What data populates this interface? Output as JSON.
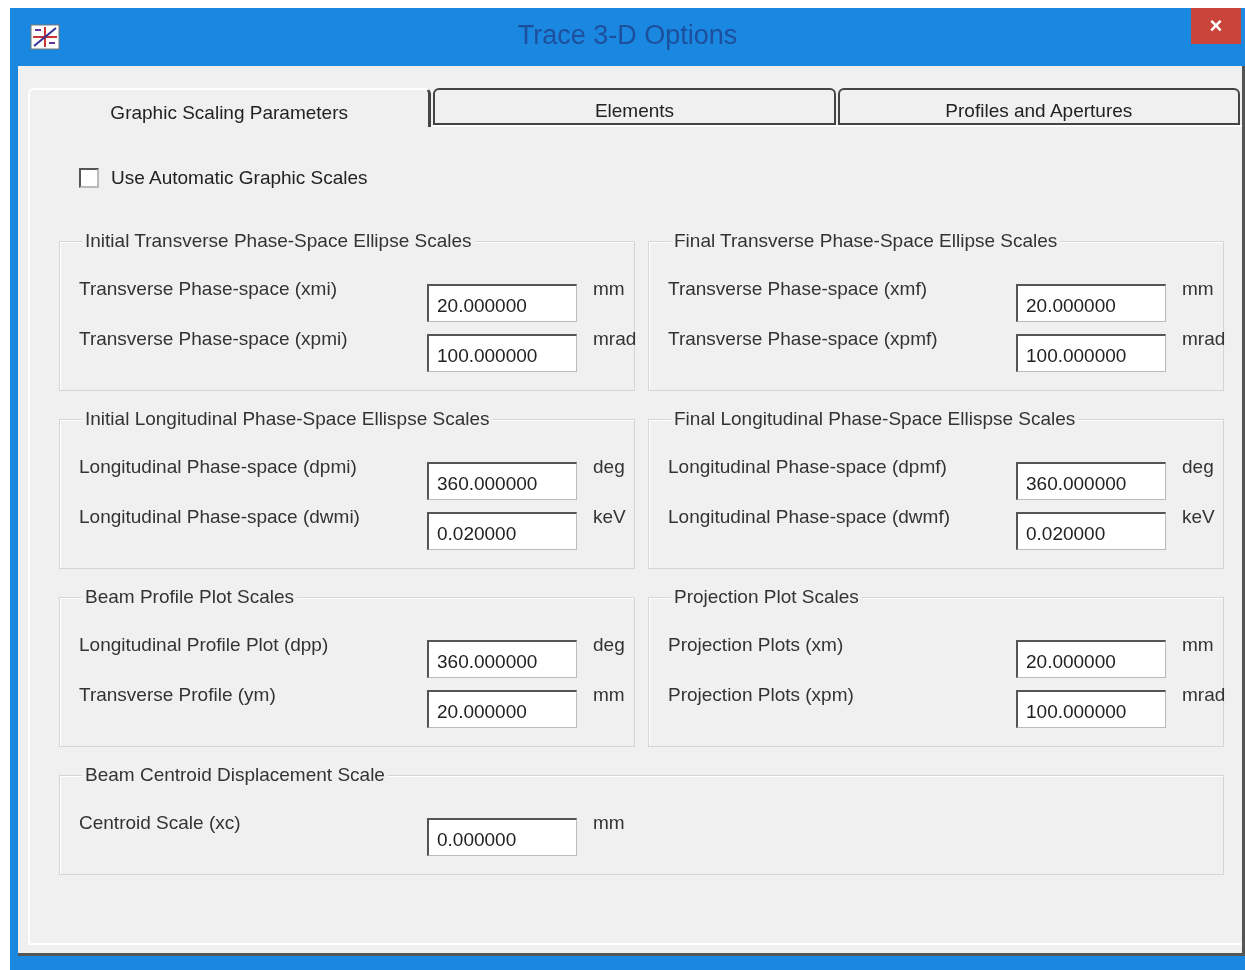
{
  "window": {
    "title": "Trace 3-D Options",
    "close": "×"
  },
  "tabs": [
    {
      "label": "Graphic Scaling Parameters",
      "selected": true
    },
    {
      "label": "Elements",
      "selected": false
    },
    {
      "label": "Profiles and Apertures",
      "selected": false
    }
  ],
  "auto_scales": {
    "label": "Use Automatic Graphic Scales",
    "checked": false
  },
  "groups": [
    {
      "title": "Initial Transverse Phase-Space Ellipse Scales",
      "fields": [
        {
          "label": "Transverse Phase-space (xmi)",
          "value": "20.000000",
          "unit": "mm"
        },
        {
          "label": "Transverse Phase-space (xpmi)",
          "value": "100.000000",
          "unit": "mrad"
        }
      ]
    },
    {
      "title": "Final Transverse Phase-Space Ellipse Scales",
      "fields": [
        {
          "label": "Transverse Phase-space (xmf)",
          "value": "20.000000",
          "unit": "mm"
        },
        {
          "label": "Transverse Phase-space (xpmf)",
          "value": "100.000000",
          "unit": "mrad"
        }
      ]
    },
    {
      "title": "Initial Longitudinal Phase-Space Ellispse Scales",
      "fields": [
        {
          "label": "Longitudinal Phase-space (dpmi)",
          "value": "360.000000",
          "unit": "deg"
        },
        {
          "label": "Longitudinal Phase-space (dwmi)",
          "value": "0.020000",
          "unit": "keV"
        }
      ]
    },
    {
      "title": "Final Longitudinal Phase-Space Ellispse Scales",
      "fields": [
        {
          "label": "Longitudinal Phase-space (dpmf)",
          "value": "360.000000",
          "unit": "deg"
        },
        {
          "label": "Longitudinal Phase-space (dwmf)",
          "value": "0.020000",
          "unit": "keV"
        }
      ]
    },
    {
      "title": "Beam Profile Plot Scales",
      "fields": [
        {
          "label": "Longitudinal Profile Plot (dpp)",
          "value": "360.000000",
          "unit": "deg"
        },
        {
          "label": "Transverse Profile (ym)",
          "value": "20.000000",
          "unit": "mm"
        }
      ]
    },
    {
      "title": "Projection Plot Scales",
      "fields": [
        {
          "label": "Projection Plots (xm)",
          "value": "20.000000",
          "unit": "mm"
        },
        {
          "label": "Projection Plots (xpm)",
          "value": "100.000000",
          "unit": "mrad"
        }
      ]
    },
    {
      "title": "Beam Centroid Displacement Scale",
      "fields": [
        {
          "label": "Centroid Scale (xc)",
          "value": "0.000000",
          "unit": "mm"
        }
      ]
    }
  ]
}
